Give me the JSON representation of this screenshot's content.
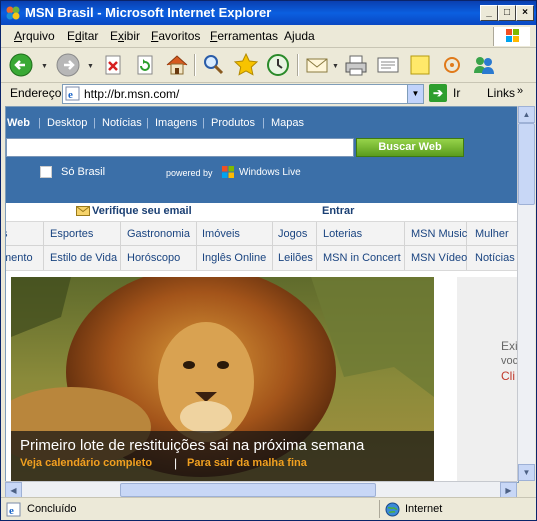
{
  "window": {
    "title": "MSN Brasil - Microsoft Internet Explorer"
  },
  "menubar": [
    "Arquivo",
    "Editar",
    "Exibir",
    "Favoritos",
    "Ferramentas",
    "Ajuda"
  ],
  "menubar_mnemonics": [
    "A",
    "d",
    "x",
    "F",
    "F",
    "j"
  ],
  "address": {
    "label": "Endereço",
    "url": "http://br.msn.com/",
    "go_label": "Ir",
    "links_label": "Links"
  },
  "msn": {
    "tabs": [
      "Web",
      "Desktop",
      "Notícias",
      "Imagens",
      "Produtos",
      "Mapas"
    ],
    "search_button": "Buscar Web",
    "so_brasil": "Só Brasil",
    "powered_by": "powered by",
    "windows_live": "Windows Live",
    "verifique_email": "Verifique seu email",
    "entrar": "Entrar",
    "categories_row1": [
      "s",
      "Esportes",
      "Gastronomia",
      "Imóveis",
      "Jogos",
      "Loterias",
      "MSN Music",
      "Mulher"
    ],
    "categories_row2": [
      "mento",
      "Estilo de Vida",
      "Horóscopo",
      "Inglês Online",
      "Leilões",
      "MSN in Concert",
      "MSN Vídeo",
      "Notícias"
    ],
    "hero": {
      "headline": "Primeiro lote de restituições sai na próxima semana",
      "link1": "Veja calendário completo",
      "separator": "|",
      "link2": "Para sair da malha fina"
    },
    "side_ad": {
      "line1": "Exi",
      "line2": "voc",
      "line3": "Cli"
    }
  },
  "status": {
    "text": "Concluído",
    "zone": "Internet"
  }
}
